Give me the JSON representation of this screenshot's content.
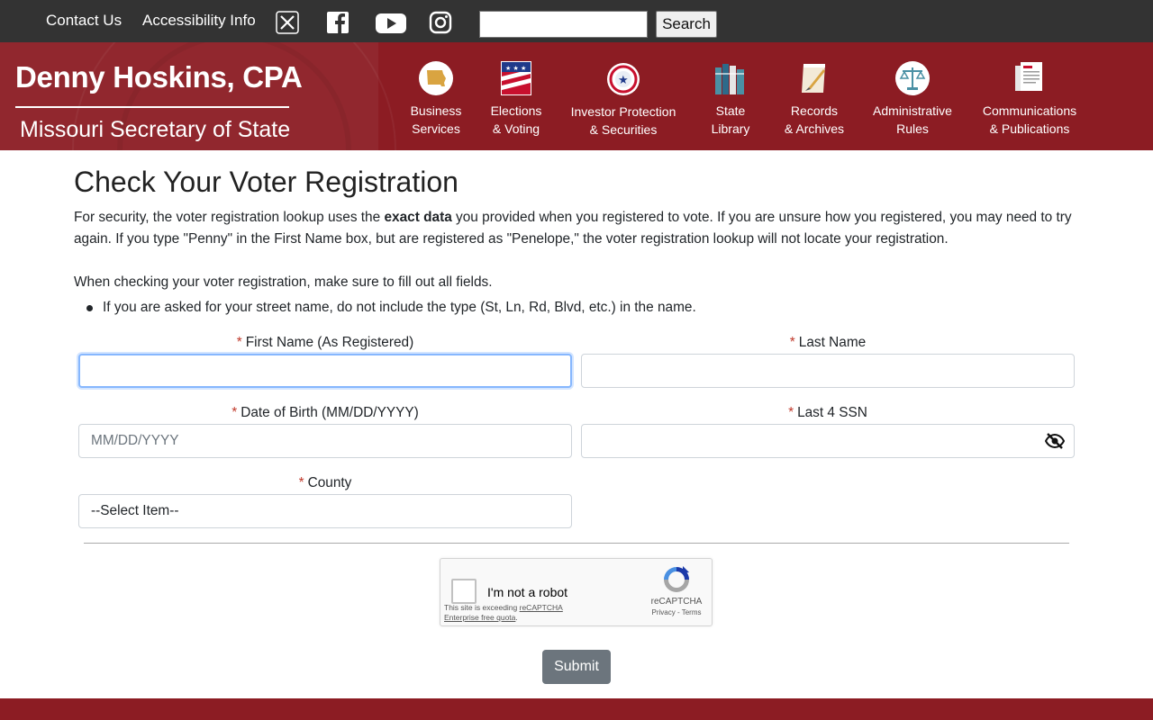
{
  "topbar": {
    "contact_label": "Contact Us",
    "accessibility_label": "Accessibility Info",
    "social": [
      "x-icon",
      "facebook-icon",
      "youtube-icon",
      "instagram-icon"
    ],
    "search_value": "",
    "search_button": "Search"
  },
  "header": {
    "name": "Denny Hoskins, CPA",
    "office": "Missouri Secretary of State",
    "bg_color": "#8c1c23",
    "nav": [
      {
        "label": "Business\nServices",
        "icon": "missouri-map-icon"
      },
      {
        "label": "Elections\n& Voting",
        "icon": "flag-icon"
      },
      {
        "label": "Investor Protection\n& Securities",
        "icon": "shield-star-icon"
      },
      {
        "label": "State\nLibrary",
        "icon": "books-icon"
      },
      {
        "label": "Records\n& Archives",
        "icon": "scroll-quill-icon"
      },
      {
        "label": "Administrative\nRules",
        "icon": "scales-icon"
      },
      {
        "label": "Communications\n& Publications",
        "icon": "documents-icon"
      }
    ]
  },
  "main": {
    "title": "Check Your Voter Registration",
    "intro_pre": "For security, the voter registration lookup uses the ",
    "intro_bold": "exact data",
    "intro_post": " you provided when you registered to vote. If you are unsure how you registered, you may need to try again. If you type \"Penny\" in the First Name box, but are registered as \"Penelope,\" the voter registration lookup will not locate your registration.",
    "note": "When checking your voter registration, make sure to fill out all fields.",
    "bullet": "If you are asked for your street name, do not include the type (St, Ln, Rd, Blvd, etc.) in the name."
  },
  "form": {
    "required_mark": "*",
    "first_name_label": "First Name (As Registered)",
    "first_name_value": "",
    "last_name_label": "Last Name",
    "last_name_value": "",
    "dob_label": "Date of Birth (MM/DD/YYYY)",
    "dob_placeholder": "MM/DD/YYYY",
    "ssn_label": "Last 4 SSN",
    "ssn_value": "",
    "county_label": "County",
    "county_selected": "--Select Item--",
    "submit_label": "Submit"
  },
  "captcha": {
    "text": "I'm not a robot",
    "warn_pre": "This site is exceeding ",
    "warn_link": "reCAPTCHA Enterprise free quota",
    "brand": "reCAPTCHA",
    "terms": "Privacy - Terms"
  }
}
